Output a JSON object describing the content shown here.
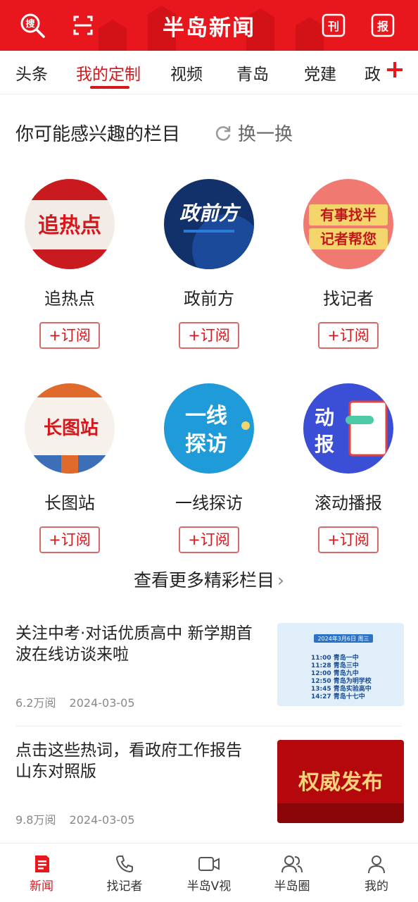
{
  "header": {
    "logo": "半岛新闻",
    "paper_glyph": "刊",
    "newspaper_glyph": "报",
    "brand_color": "#e8171d",
    "icons": [
      "search-icon",
      "scan-icon",
      "epaper-icon",
      "newspaper-icon"
    ]
  },
  "tabs": [
    {
      "label": "头条"
    },
    {
      "label": "我的定制",
      "active": true
    },
    {
      "label": "视频"
    },
    {
      "label": "青岛"
    },
    {
      "label": "党建"
    },
    {
      "label": "政"
    }
  ],
  "recommend": {
    "title": "你可能感兴趣的栏目",
    "refresh_label": "换一换",
    "items": [
      {
        "name": "追热点",
        "cover_text": "追热点",
        "subscribe": "+订阅"
      },
      {
        "name": "政前方",
        "cover_text": "政前方",
        "subscribe": "+订阅"
      },
      {
        "name": "找记者",
        "cover_text": "有事找半\n记者帮您",
        "subscribe": "+订阅"
      },
      {
        "name": "长图站",
        "cover_text": "长图站",
        "subscribe": "+订阅"
      },
      {
        "name": "一线探访",
        "cover_text": "一线\n探访",
        "subscribe": "+订阅"
      },
      {
        "name": "滚动播报",
        "cover_text": "动\n报",
        "subscribe": "+订阅"
      }
    ],
    "more_label": "查看更多精彩栏目"
  },
  "news": [
    {
      "title": "关注中考·对话优质高中 新学期首波在线访谈来啦",
      "views": "6.2万阅",
      "date": "2024-03-05",
      "thumb": {
        "date_label": "2024年3月6日 周三",
        "schedule": [
          "11:00 青岛一中",
          "11:28 青岛三中",
          "12:00 青岛九中",
          "12:50 青岛为明学校",
          "13:45 青岛实验高中",
          "14:27 青岛十七中"
        ]
      }
    },
    {
      "title": "点击这些热词，看政府工作报告山东对照版",
      "views": "9.8万阅",
      "date": "2024-03-05",
      "thumb": {
        "text": "权威发布"
      }
    }
  ],
  "bottom_nav": [
    {
      "label": "新闻",
      "icon": "news-icon",
      "active": true
    },
    {
      "label": "找记者",
      "icon": "phone-icon"
    },
    {
      "label": "半岛V视",
      "icon": "video-icon"
    },
    {
      "label": "半岛圈",
      "icon": "community-icon"
    },
    {
      "label": "我的",
      "icon": "profile-icon"
    }
  ]
}
